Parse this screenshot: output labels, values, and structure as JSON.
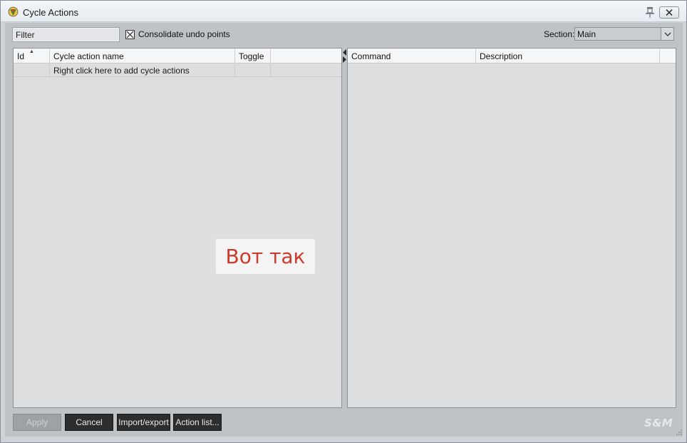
{
  "window": {
    "title": "Cycle Actions"
  },
  "toolbar": {
    "filter_placeholder": "Filter",
    "consolidate_label": "Consolidate undo points",
    "consolidate_checked": true,
    "section_label": "Section:",
    "section_value": "Main"
  },
  "left_table": {
    "columns": [
      "Id",
      "Cycle action name",
      "Toggle",
      ""
    ],
    "rows": [
      {
        "id": "",
        "name": "Right click here to add cycle actions",
        "toggle": ""
      }
    ]
  },
  "right_table": {
    "columns": [
      "Command",
      "Description",
      ""
    ]
  },
  "overlay": {
    "text": "Вот так"
  },
  "buttons": {
    "apply": "Apply",
    "cancel": "Cancel",
    "import_export": "Import/export",
    "action_list": "Action list..."
  },
  "brand": "S&M",
  "colors": {
    "overlay_text": "#cc3a2c",
    "button_dark": "#2d2d2d",
    "panel_bg": "#dcdedf"
  },
  "icons": {
    "app": "reaper-logo-icon",
    "pin": "pin-icon",
    "close": "close-icon",
    "dropdown": "chevron-down-icon",
    "sort": "sort-ascending-icon"
  }
}
